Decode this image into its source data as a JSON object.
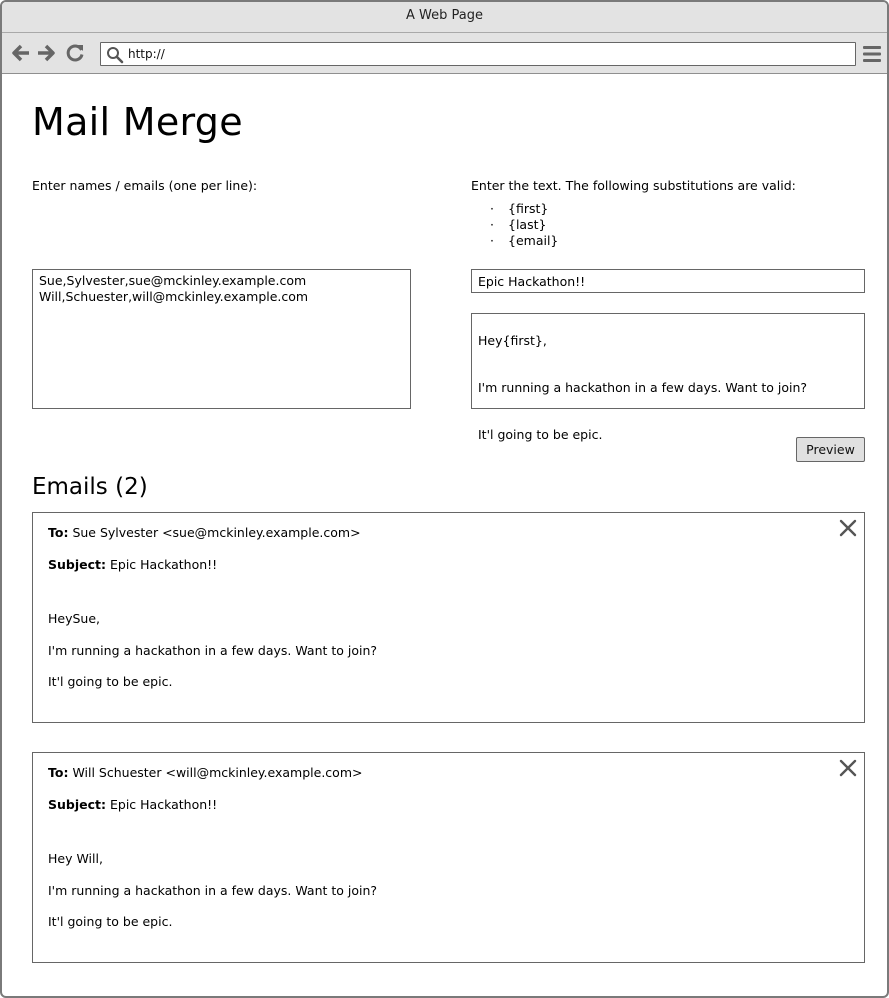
{
  "window": {
    "title": "A Web Page"
  },
  "browser": {
    "url": "http://"
  },
  "page": {
    "title": "Mail Merge"
  },
  "left": {
    "label": "Enter names / emails (one per line):",
    "names_value": "Sue,Sylvester,sue@mckinley.example.com\nWill,Schuester,will@mckinley.example.com"
  },
  "right": {
    "label": "Enter the text.  The following substitutions are valid:",
    "substitutions": [
      "{first}",
      "{last}",
      "{email}"
    ],
    "subject_value": "Epic Hackathon!!",
    "body_lines": [
      "Hey{first},",
      "I'm running a hackathon in a few days.  Want to join?",
      "It'l going to be epic."
    ]
  },
  "actions": {
    "preview_label": "Preview"
  },
  "emails": {
    "heading": "Emails (2)",
    "to_label": "To:",
    "subject_label": "Subject:",
    "items": [
      {
        "to": "Sue Sylvester <sue@mckinley.example.com>",
        "subject": "Epic Hackathon!!",
        "greeting": "HeySue,",
        "line1": "I'm running a hackathon in a few days.  Want to join?",
        "line2": "It'l going to be epic."
      },
      {
        "to": "Will Schuester <will@mckinley.example.com>",
        "subject": "Epic Hackathon!!",
        "greeting": "Hey Will,",
        "line1": "I'm running a hackathon in a few days.  Want to join?",
        "line2": "It'l going to be epic."
      }
    ]
  },
  "icons": {
    "back": "back-arrow-icon",
    "forward": "forward-arrow-icon",
    "reload": "reload-icon",
    "search": "search-icon",
    "menu": "hamburger-menu-icon",
    "close": "close-icon"
  }
}
